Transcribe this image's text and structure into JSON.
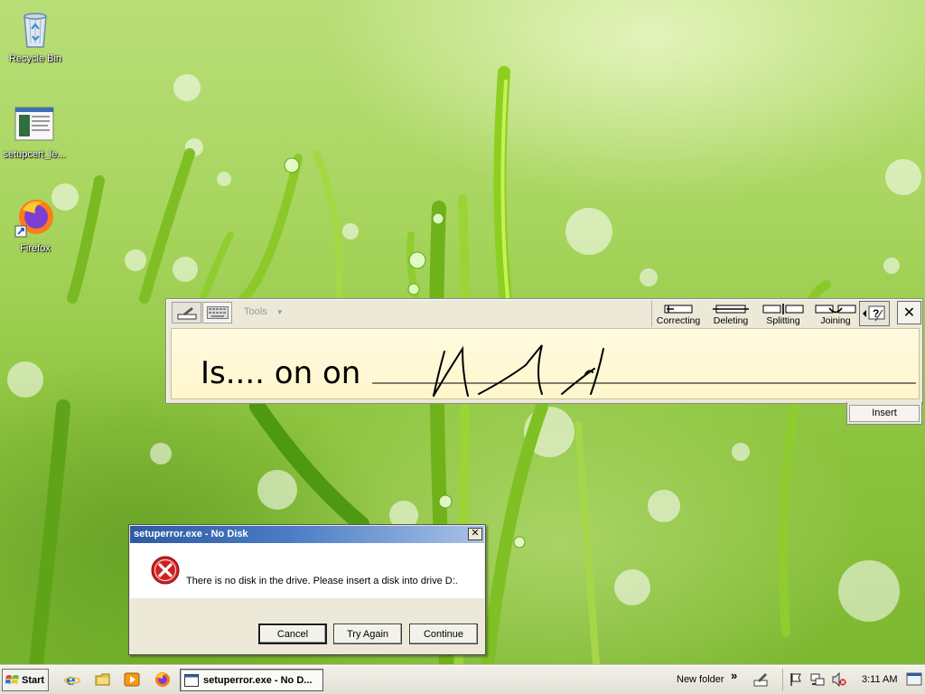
{
  "desktop": {
    "icons": [
      {
        "label": "Recycle Bin"
      },
      {
        "label": "setupcert_le..."
      },
      {
        "label": "Firefox"
      }
    ]
  },
  "input_panel": {
    "tools_label": "Tools",
    "actions": [
      {
        "label": "Correcting"
      },
      {
        "label": "Deleting"
      },
      {
        "label": "Splitting"
      },
      {
        "label": "Joining"
      }
    ],
    "handwriting_text": "Is.... on on",
    "insert_label": "Insert"
  },
  "dialog": {
    "title": "setuperror.exe - No Disk",
    "message": "There is no disk in the drive. Please insert a disk into drive D:.",
    "buttons": {
      "cancel": "Cancel",
      "try_again": "Try Again",
      "continue": "Continue"
    },
    "close_label": "✕"
  },
  "taskbar": {
    "start_label": "Start",
    "active_task": "setuperror.exe - No D...",
    "toolbar_label": "New folder",
    "chevron": "»",
    "clock": "3:11 AM"
  }
}
